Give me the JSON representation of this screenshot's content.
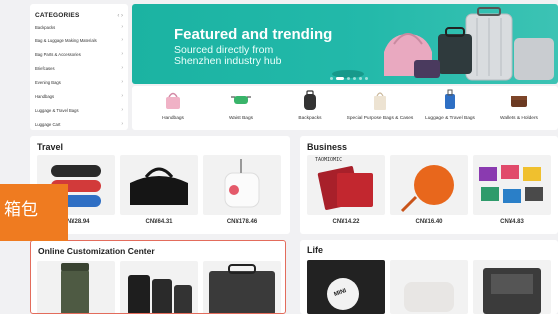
{
  "sidebar": {
    "title": "CATEGORIES",
    "arrows": "‹ ›",
    "items": [
      {
        "label": "Backpacks"
      },
      {
        "label": "Bag & Luggage Making Materials"
      },
      {
        "label": "Bag Parts & Accessories"
      },
      {
        "label": "Briefcases"
      },
      {
        "label": "Evening Bags"
      },
      {
        "label": "Handbags"
      },
      {
        "label": "Luggage & Travel Bags"
      },
      {
        "label": "Luggage Cart"
      }
    ]
  },
  "banner": {
    "title": "Featured and trending",
    "subtitle_line1": "Sourced directly from",
    "subtitle_line2": "Shenzhen industry hub",
    "bg_color": "#1bb3a2"
  },
  "categories": [
    {
      "label": "Handbags"
    },
    {
      "label": "Waist Bags"
    },
    {
      "label": "Backpacks"
    },
    {
      "label": "Special Purpose Bags & Cases"
    },
    {
      "label": "Luggage & Travel Bags"
    },
    {
      "label": "Wallets & Holders"
    }
  ],
  "sections": {
    "travel": {
      "title": "Travel",
      "prices": [
        "CN¥28.94",
        "CN¥64.31",
        "CN¥178.46"
      ]
    },
    "business": {
      "title": "Business",
      "brand_tag": "TAOMIOMIC",
      "prices": [
        "CN¥14.22",
        "CN¥16.40",
        "CN¥4.83"
      ]
    },
    "customization": {
      "title": "Online Customization Center"
    },
    "life": {
      "title": "Life",
      "brand_tag": "MINI"
    }
  },
  "overlay": {
    "text": "箱包",
    "color": "#ef7b20"
  },
  "colors": {
    "accent": "#1bb3a2",
    "highlight_border": "#e36c5c"
  }
}
